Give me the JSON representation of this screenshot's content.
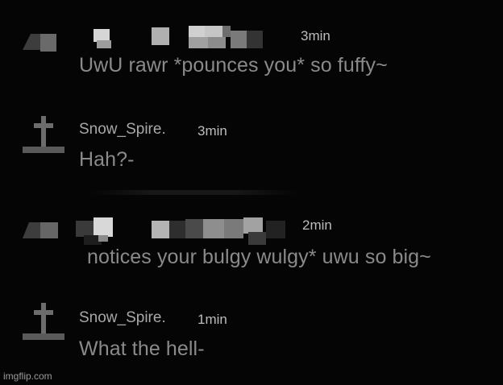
{
  "messages": [
    {
      "username": "",
      "time": "3min",
      "text": "UwU rawr *pounces you* so fuffy~",
      "avatar_icon": "censored-avatar-icon"
    },
    {
      "username": "Snow_Spire.",
      "time": "3min",
      "text": "Hah?-",
      "avatar_icon": "grave-cross-icon"
    },
    {
      "username": "",
      "time": "2min",
      "text": "notices your bulgy wulgy* uwu so big~",
      "avatar_icon": "censored-avatar-icon"
    },
    {
      "username": "Snow_Spire.",
      "time": "1min",
      "text": "What the hell-",
      "avatar_icon": "grave-cross-icon"
    }
  ],
  "watermark": "imgflip.com",
  "colors": {
    "background": "#050505",
    "username": "#a8a8a8",
    "time": "#bcbcbc",
    "message": "#8a8a8a",
    "censor_light": "#9a9a9a",
    "censor_dark": "#3a3a3a"
  }
}
